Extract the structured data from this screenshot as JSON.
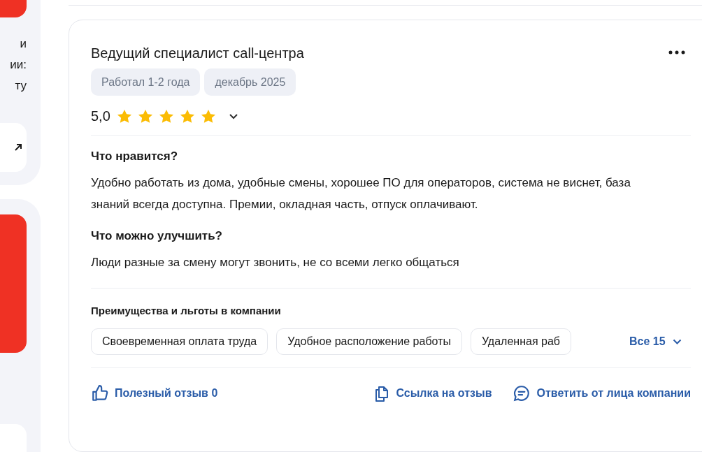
{
  "sidebar": {
    "fragments": [
      "и",
      "ии:",
      "ту"
    ]
  },
  "review": {
    "title": "Ведущий специалист call-центра",
    "tags": [
      "Работал 1-2 года",
      "декабрь 2025"
    ],
    "rating": "5,0",
    "stars": 5,
    "sections": [
      {
        "heading": "Что нравится?",
        "text": "Удобно работать из дома, удобные смены, хорошее ПО для операторов, система не виснет, база знаний всегда доступна. Премии, окладная часть, отпуск оплачивают."
      },
      {
        "heading": "Что можно улучшить?",
        "text": "Люди разные за смену могут звонить, не со всеми легко общаться"
      }
    ],
    "benefits": {
      "heading": "Преимущества и льготы в компании",
      "items": [
        "Своевременная оплата труда",
        "Удобное расположение работы",
        "Удаленная раб"
      ],
      "more": "Все 15"
    },
    "actions": {
      "useful": "Полезный отзыв 0",
      "link": "Ссылка на отзыв",
      "reply": "Ответить от лица компании"
    }
  }
}
